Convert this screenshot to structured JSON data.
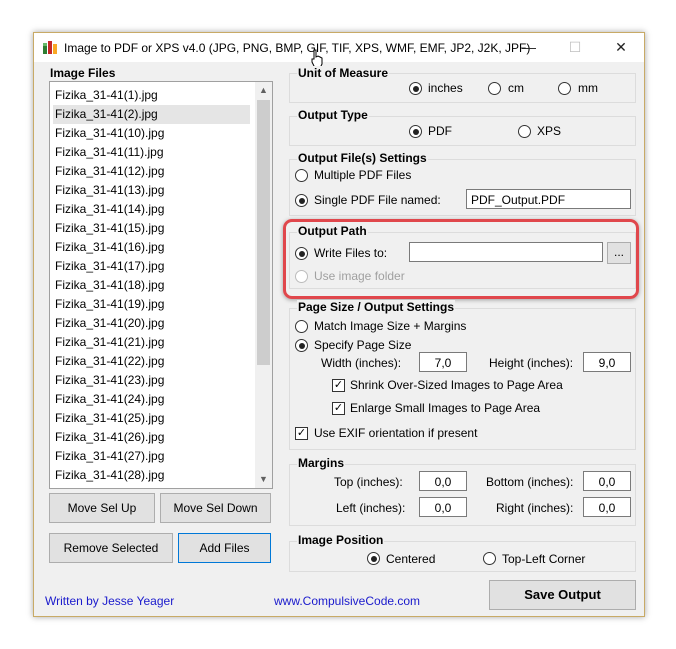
{
  "window": {
    "title": "Image to PDF or XPS  v4.0  (JPG, PNG, BMP, GIF, TIF, XPS, WMF, EMF, JP2, J2K, JPF)",
    "minimize_glyph": "—",
    "maximize_glyph": "☐",
    "close_glyph": "✕"
  },
  "image_files": {
    "label": "Image Files",
    "items": [
      "Fizika_31-41(1).jpg",
      "Fizika_31-41(2).jpg",
      "Fizika_31-41(10).jpg",
      "Fizika_31-41(11).jpg",
      "Fizika_31-41(12).jpg",
      "Fizika_31-41(13).jpg",
      "Fizika_31-41(14).jpg",
      "Fizika_31-41(15).jpg",
      "Fizika_31-41(16).jpg",
      "Fizika_31-41(17).jpg",
      "Fizika_31-41(18).jpg",
      "Fizika_31-41(19).jpg",
      "Fizika_31-41(20).jpg",
      "Fizika_31-41(21).jpg",
      "Fizika_31-41(22).jpg",
      "Fizika_31-41(23).jpg",
      "Fizika_31-41(24).jpg",
      "Fizika_31-41(25).jpg",
      "Fizika_31-41(26).jpg",
      "Fizika_31-41(27).jpg",
      "Fizika_31-41(28).jpg"
    ],
    "selected_index": 1
  },
  "buttons": {
    "move_up": "Move Sel Up",
    "move_down": "Move Sel Down",
    "remove": "Remove Selected",
    "add": "Add Files",
    "save": "Save Output",
    "browse": "..."
  },
  "unit_of_measure": {
    "title": "Unit of Measure",
    "options": [
      "inches",
      "cm",
      "mm"
    ],
    "selected": "inches"
  },
  "output_type": {
    "title": "Output Type",
    "options": [
      "PDF",
      "XPS"
    ],
    "selected": "PDF"
  },
  "output_files": {
    "title": "Output File(s) Settings",
    "multiple": "Multiple PDF Files",
    "single": "Single PDF File named:",
    "filename": "PDF_Output.PDF",
    "selected": "single"
  },
  "output_path": {
    "title": "Output Path",
    "write_files": "Write Files to:",
    "path_value": "",
    "use_image_folder": "Use image folder"
  },
  "page_size": {
    "title": "Page Size / Output Settings",
    "match": "Match Image Size + Margins",
    "specify": "Specify Page Size",
    "width_label": "Width (inches):",
    "width_value": "7,0",
    "height_label": "Height (inches):",
    "height_value": "9,0",
    "shrink": "Shrink Over-Sized Images to Page Area",
    "enlarge": "Enlarge Small Images to Page Area",
    "exif": "Use EXIF orientation if present"
  },
  "margins": {
    "title": "Margins",
    "top_label": "Top (inches):",
    "top_value": "0,0",
    "bottom_label": "Bottom (inches):",
    "bottom_value": "0,0",
    "left_label": "Left (inches):",
    "left_value": "0,0",
    "right_label": "Right (inches):",
    "right_value": "0,0"
  },
  "image_position": {
    "title": "Image Position",
    "centered": "Centered",
    "top_left": "Top-Left Corner",
    "selected": "Centered"
  },
  "footer": {
    "author": "Written by Jesse Yeager",
    "website": "www.CompulsiveCode.com"
  },
  "colors": {
    "highlight": "#e0474c",
    "link": "#1a1acc"
  }
}
